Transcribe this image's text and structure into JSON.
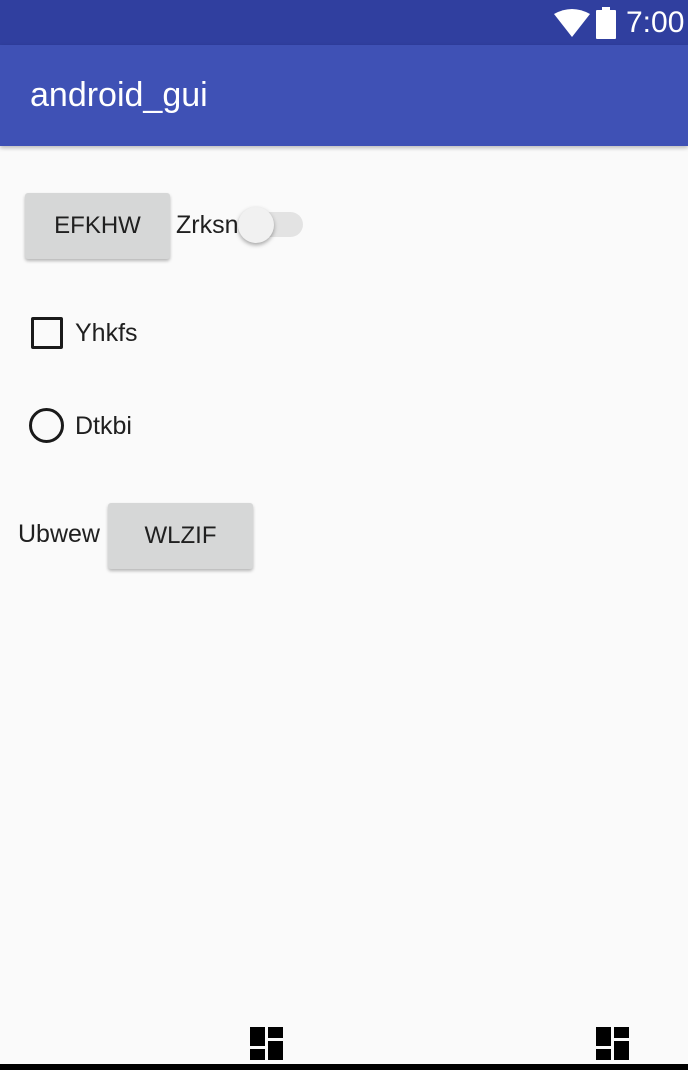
{
  "status_bar": {
    "time": "7:00",
    "icons": [
      "wifi-icon",
      "battery-icon"
    ],
    "color": "#303f9f"
  },
  "app_bar": {
    "title": "android_gui",
    "color": "#3f51b5"
  },
  "main": {
    "button_1": "EFKHW",
    "switch_label": "Zrksn",
    "switch_on": false,
    "checkbox_label": "Yhkfs",
    "checkbox_checked": false,
    "radio_label": "Dtkbi",
    "radio_selected": false,
    "row_label": "Ubwew",
    "button_2": "WLZIF"
  },
  "nav": {
    "icons": [
      "dashboard-icon",
      "dashboard-icon"
    ]
  }
}
